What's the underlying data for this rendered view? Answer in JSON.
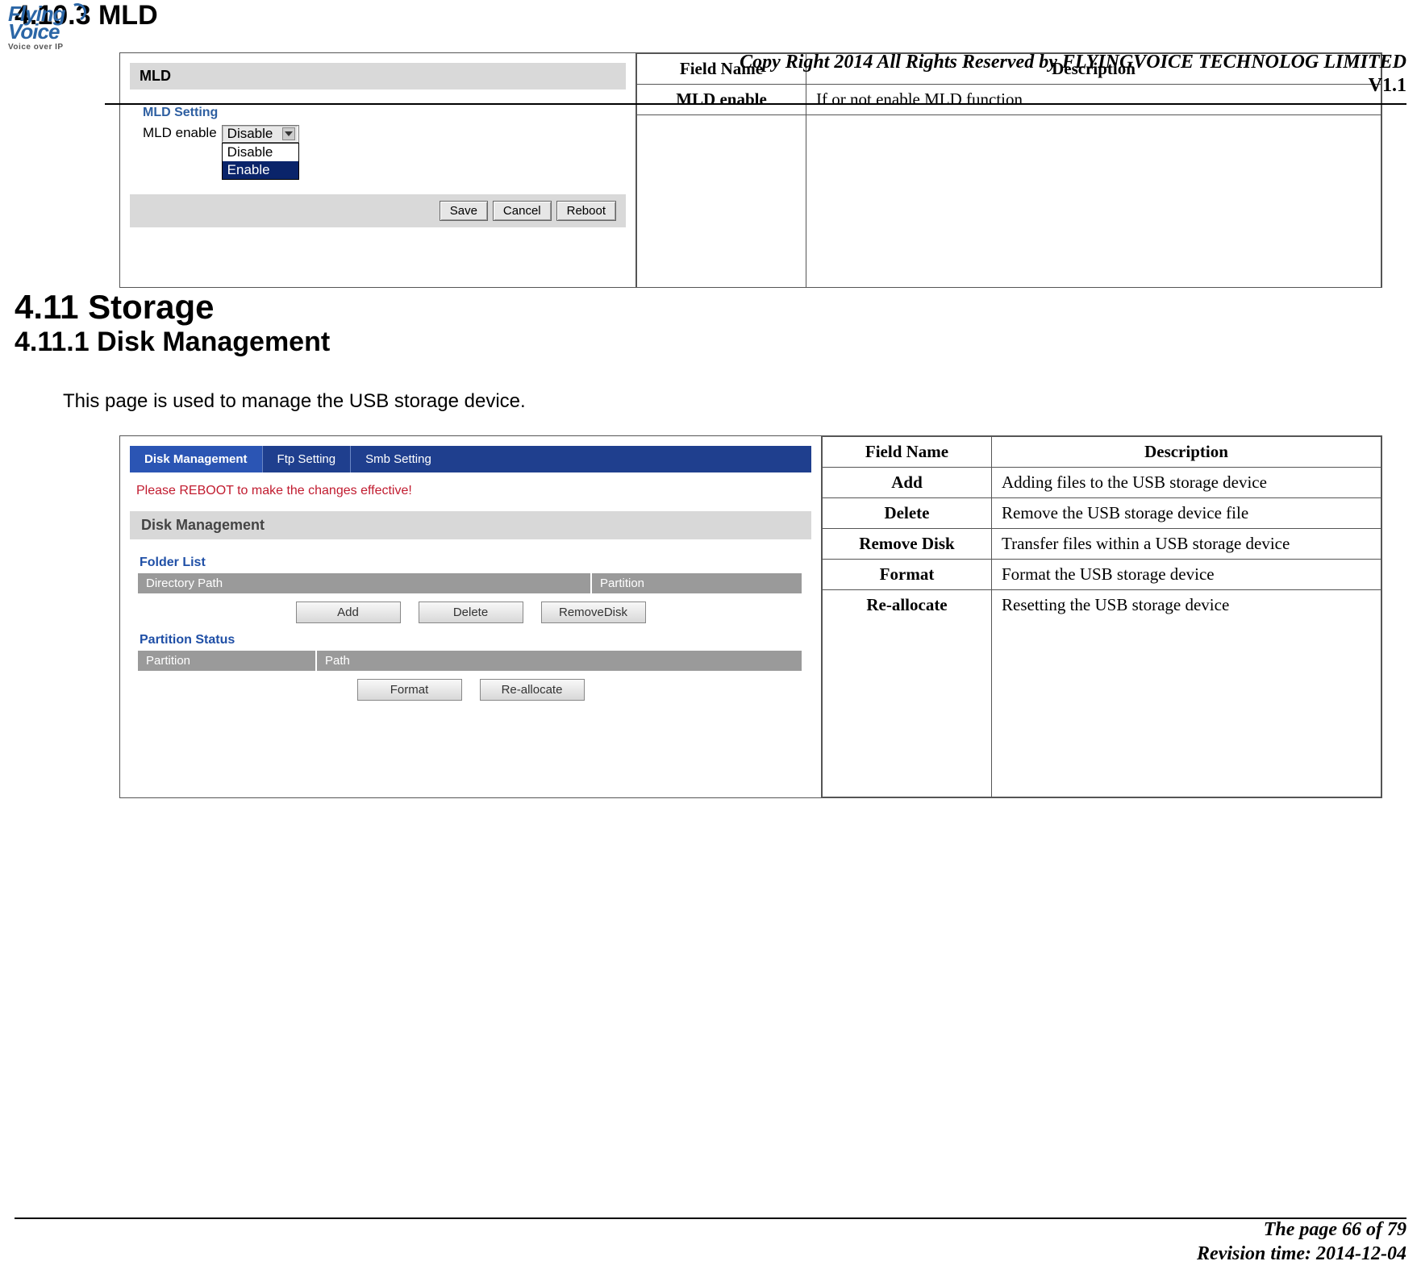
{
  "header": {
    "logo": {
      "line1": "Flying",
      "line2": "Voice",
      "tagline": "Voice over IP"
    },
    "copyright": "Copy Right 2014 All Rights Reserved by FLYINGVOICE TECHNOLOG LIMITED",
    "version": "V1.1"
  },
  "sections": {
    "h_4103": "4.10.3  MLD",
    "h_411": "4.11  Storage",
    "h_4111": "4.11.1   Disk Management",
    "disk_intro": "This page is used to manage the USB storage device."
  },
  "mld": {
    "table": {
      "header": {
        "field": "Field Name",
        "desc": "Description"
      },
      "rows": [
        {
          "field": "MLD enable",
          "desc": "If or not enable MLD function"
        }
      ]
    },
    "shot": {
      "bar": "MLD",
      "setting_title": "MLD Setting",
      "label": "MLD enable",
      "selected": "Disable",
      "options": [
        "Disable",
        "Enable"
      ],
      "buttons": {
        "save": "Save",
        "cancel": "Cancel",
        "reboot": "Reboot"
      }
    }
  },
  "disk": {
    "table": {
      "header": {
        "field": "Field Name",
        "desc": "Description"
      },
      "rows": [
        {
          "field": "Add",
          "desc": "Adding files to the USB storage device"
        },
        {
          "field": "Delete",
          "desc": "Remove the USB storage device file"
        },
        {
          "field": "Remove Disk",
          "desc": "Transfer files within a USB storage device"
        },
        {
          "field": "Format",
          "desc": "Format the USB storage device"
        },
        {
          "field": "Re-allocate",
          "desc": "Resetting the USB storage device"
        }
      ]
    },
    "shot": {
      "tabs": [
        "Disk Management",
        "Ftp Setting",
        "Smb Setting"
      ],
      "warn": "Please REBOOT to make the changes effective!",
      "panel": "Disk Management",
      "folder_title": "Folder List",
      "folder_cols": [
        "Directory Path",
        "Partition"
      ],
      "folder_buttons": {
        "add": "Add",
        "delete": "Delete",
        "remove": "RemoveDisk"
      },
      "part_title": "Partition Status",
      "part_cols": [
        "Partition",
        "Path"
      ],
      "part_buttons": {
        "format": "Format",
        "realloc": "Re-allocate"
      }
    }
  },
  "footer": {
    "page": "The page 66 of 79",
    "revision": "Revision time: 2014-12-04"
  }
}
